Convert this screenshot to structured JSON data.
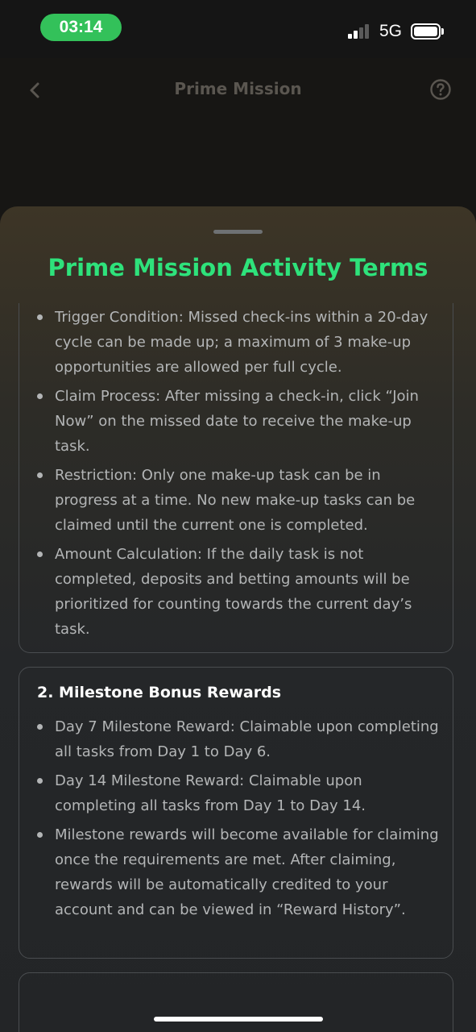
{
  "status_bar": {
    "time": "03:14",
    "network": "5G",
    "colors": {
      "time_pill": "#33c15a"
    }
  },
  "background_page": {
    "title": "Prime Mission",
    "icons": {
      "back": "chevron-left-icon",
      "help": "question-circle-icon"
    }
  },
  "sheet": {
    "title": "Prime Mission Activity Terms",
    "accent_color": "#2ee27b",
    "section1": {
      "items": [
        "Trigger Condition: Missed check-ins within a 20-day cycle can be made up; a maximum of 3 make-up opportunities are allowed per full cycle.",
        "Claim Process: After missing a check-in, click “Join Now” on the missed date to receive the make-up task.",
        "Restriction: Only one make-up task can be in progress at a time. No new make-up tasks can be claimed until the current one is completed.",
        "Amount Calculation: If the daily task is not completed, deposits and betting amounts will be prioritized for counting towards the current day’s task."
      ]
    },
    "section2": {
      "heading": "2. Milestone Bonus Rewards",
      "items": [
        "Day 7 Milestone Reward: Claimable upon completing all tasks from Day 1 to Day 6.",
        "Day 14 Milestone Reward: Claimable upon completing all tasks from Day 1 to Day 14.",
        "Milestone rewards will become available for claiming once the requirements are met. After claiming, rewards will be automatically credited to your account and can be viewed in “Reward History”."
      ]
    }
  }
}
